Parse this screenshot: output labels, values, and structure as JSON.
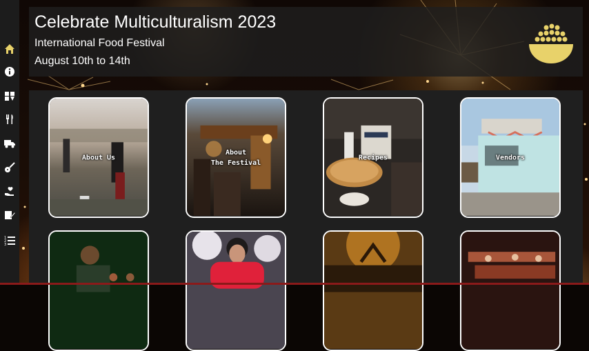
{
  "header": {
    "title": "Celebrate Multiculturalism 2023",
    "subtitle": "International Food Festival",
    "dates": "August 10th to 14th",
    "logo_icon": "food-bowl-icon",
    "logo_color": "#e8d26a"
  },
  "sidebar": {
    "items": [
      {
        "name": "home",
        "icon": "home-icon",
        "active": true
      },
      {
        "name": "info",
        "icon": "info-icon"
      },
      {
        "name": "recipes",
        "icon": "recipe-icon"
      },
      {
        "name": "food",
        "icon": "utensils-icon"
      },
      {
        "name": "vendors",
        "icon": "truck-icon"
      },
      {
        "name": "music",
        "icon": "guitar-icon"
      },
      {
        "name": "volunteer",
        "icon": "hand-heart-icon"
      },
      {
        "name": "register",
        "icon": "signature-icon"
      },
      {
        "name": "schedule",
        "icon": "list-ordered-icon"
      }
    ],
    "active_color": "#e8d26a",
    "icon_color": "#ffffff"
  },
  "cards": [
    {
      "label": "About Us"
    },
    {
      "label": "About\nThe Festival"
    },
    {
      "label": "Recipes"
    },
    {
      "label": "Vendors"
    },
    {
      "label": ""
    },
    {
      "label": ""
    },
    {
      "label": ""
    },
    {
      "label": ""
    }
  ]
}
